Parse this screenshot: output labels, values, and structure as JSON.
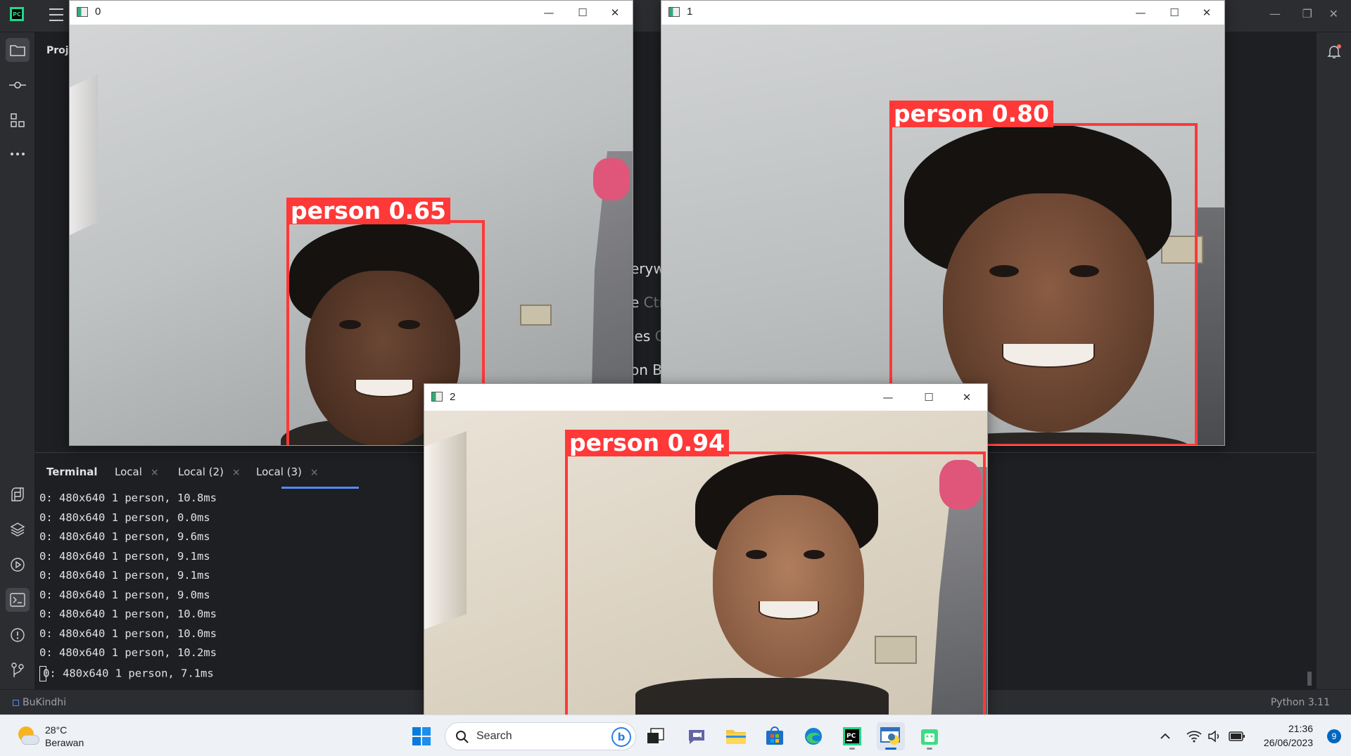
{
  "ide": {
    "logo": "PC",
    "project_title": "Proje",
    "bg_fragments": [
      "eryw",
      "e",
      "Ctr",
      "les",
      "C",
      "on Ba"
    ],
    "terminal": {
      "tabs": [
        {
          "label": "Terminal"
        },
        {
          "label": "Local",
          "close": "×"
        },
        {
          "label": "Local (2)",
          "close": "×"
        },
        {
          "label": "Local (3)",
          "close": "×"
        }
      ],
      "lines": [
        "0: 480x640 1 person, 10.8ms",
        "0: 480x640 1 person, 0.0ms",
        "0: 480x640 1 person, 9.6ms",
        "0: 480x640 1 person, 9.1ms",
        "0: 480x640 1 person, 9.1ms",
        "0: 480x640 1 person, 9.0ms",
        "0: 480x640 1 person, 10.0ms",
        "0: 480x640 1 person, 10.0ms",
        "0: 480x640 1 person, 10.2ms",
        "0: 480x640 1 person, 7.1ms"
      ]
    },
    "status": {
      "project": "BuKindhi",
      "interpreter": "Python 3.11"
    }
  },
  "windows": [
    {
      "title": "0",
      "detection": "person 0.65"
    },
    {
      "title": "1",
      "detection": "person 0.80"
    },
    {
      "title": "2",
      "detection": "person 0.94"
    }
  ],
  "taskbar": {
    "weather": {
      "temp": "28°C",
      "condition": "Berawan"
    },
    "search_placeholder": "Search",
    "time": "21:36",
    "date": "26/06/2023",
    "notification_count": "9"
  }
}
